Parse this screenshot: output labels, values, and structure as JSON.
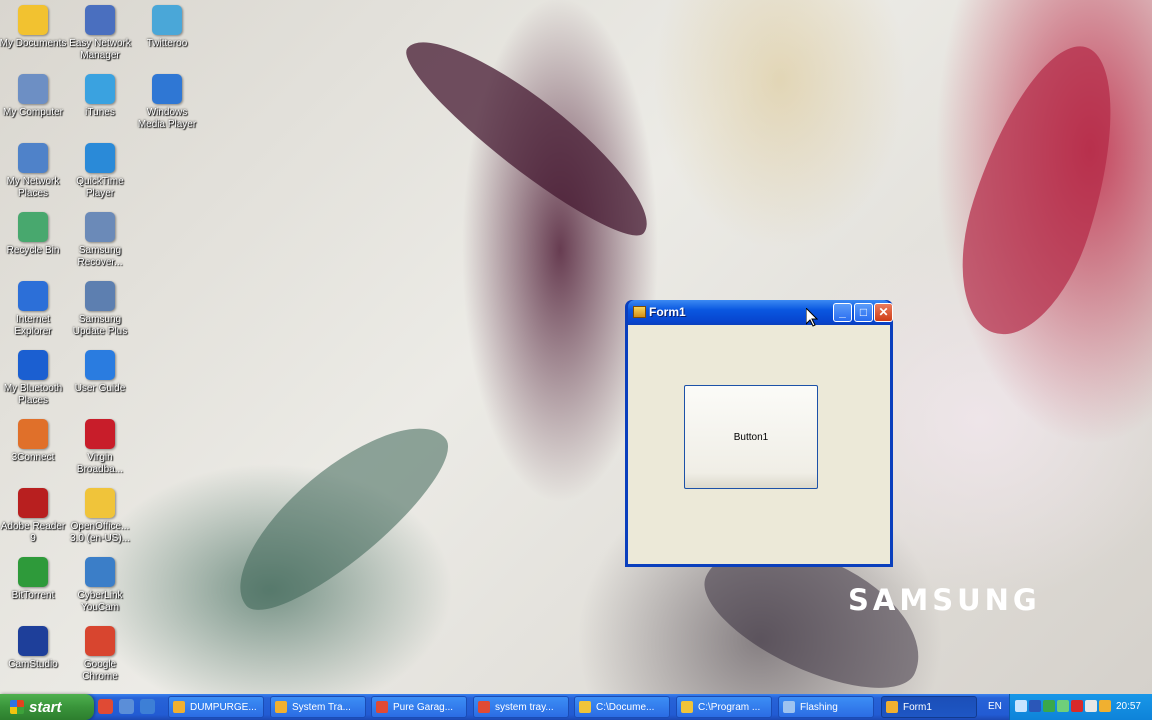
{
  "desktop": {
    "icons": [
      {
        "label": "My Documents",
        "icon": "folder-documents-icon",
        "color": "#f2c230"
      },
      {
        "label": "Easy Network Manager",
        "icon": "network-manager-icon",
        "color": "#4a6fbf"
      },
      {
        "label": "Twitteroo",
        "icon": "bird-icon",
        "color": "#4aa7d8"
      },
      {
        "label": "My Computer",
        "icon": "computer-icon",
        "color": "#6d8fc4"
      },
      {
        "label": "iTunes",
        "icon": "music-note-icon",
        "color": "#3aa2e0"
      },
      {
        "label": "Windows Media Player",
        "icon": "media-player-icon",
        "color": "#2f77d4"
      },
      {
        "label": "My Network Places",
        "icon": "network-places-icon",
        "color": "#4f82c9"
      },
      {
        "label": "QuickTime Player",
        "icon": "quicktime-icon",
        "color": "#2a8ad8"
      },
      {
        "label": "Recycle Bin",
        "icon": "recycle-bin-icon",
        "color": "#48a86e"
      },
      {
        "label": "Samsung Recover...",
        "icon": "samsung-recovery-icon",
        "color": "#6b8ab8"
      },
      {
        "label": "Internet Explorer",
        "icon": "internet-explorer-icon",
        "color": "#2c6fd8"
      },
      {
        "label": "Samsung Update Plus",
        "icon": "samsung-update-icon",
        "color": "#5d7fb0"
      },
      {
        "label": "My Bluetooth Places",
        "icon": "bluetooth-icon",
        "color": "#1b5fd1"
      },
      {
        "label": "User Guide",
        "icon": "user-guide-icon",
        "color": "#2a7ce0"
      },
      {
        "label": "3Connect",
        "icon": "three-connect-icon",
        "color": "#e0702a"
      },
      {
        "label": "Virgin Broadba...",
        "icon": "virgin-broadband-icon",
        "color": "#c81d2a"
      },
      {
        "label": "Adobe Reader 9",
        "icon": "adobe-reader-icon",
        "color": "#b81f1f"
      },
      {
        "label": "OpenOffice... 3.0 (en-US)...",
        "icon": "folder-icon",
        "color": "#f0c43a"
      },
      {
        "label": "BitTorrent",
        "icon": "bittorrent-icon",
        "color": "#2e9a3a"
      },
      {
        "label": "CyberLink YouCam",
        "icon": "webcam-icon",
        "color": "#3b7ec8"
      },
      {
        "label": "CamStudio",
        "icon": "camstudio-icon",
        "color": "#1e3f9a"
      },
      {
        "label": "Google Chrome",
        "icon": "chrome-icon",
        "color": "#d8452f"
      }
    ],
    "brand_text": "SAMSUNG"
  },
  "window": {
    "title": "Form1",
    "minimize_glyph": "_",
    "maximize_glyph": "□",
    "close_glyph": "✕",
    "button_label": "Button1"
  },
  "taskbar": {
    "start_label": "start",
    "quick_launch": [
      {
        "icon": "chrome-icon",
        "color": "#e04a34"
      },
      {
        "icon": "desktop-icon",
        "color": "#5b8ed8"
      },
      {
        "icon": "explorer-icon",
        "color": "#3d7fd6"
      }
    ],
    "tasks": [
      {
        "label": "DUMPURGE...",
        "icon": "app-icon",
        "color": "#f0b030",
        "active": false
      },
      {
        "label": "System Tra...",
        "icon": "app-icon",
        "color": "#f0b030",
        "active": false
      },
      {
        "label": "Pure Garag...",
        "icon": "chrome-icon",
        "color": "#e04a34",
        "active": false
      },
      {
        "label": "system tray...",
        "icon": "chrome-icon",
        "color": "#e04a34",
        "active": false
      },
      {
        "label": "C:\\Docume...",
        "icon": "folder-icon",
        "color": "#f0c43a",
        "active": false
      },
      {
        "label": "C:\\Program ...",
        "icon": "folder-icon",
        "color": "#f0c43a",
        "active": false
      },
      {
        "label": "Flashing",
        "icon": "app-icon",
        "color": "#9ec3f0",
        "active": false
      },
      {
        "label": "Form1",
        "icon": "form-icon",
        "color": "#f0b030",
        "active": true
      }
    ],
    "language": "EN",
    "tray_icons": [
      {
        "icon": "network-icon",
        "color": "#c8e4ff"
      },
      {
        "icon": "monitor-icon",
        "color": "#2b57b8"
      },
      {
        "icon": "security-icon",
        "color": "#3aa84a"
      },
      {
        "icon": "wifi-icon",
        "color": "#6fcf7a"
      },
      {
        "icon": "flash-icon",
        "color": "#d82a2a"
      },
      {
        "icon": "volume-icon",
        "color": "#e6e6e6"
      },
      {
        "icon": "shield-icon",
        "color": "#f0b030"
      }
    ],
    "clock": "20:57"
  }
}
